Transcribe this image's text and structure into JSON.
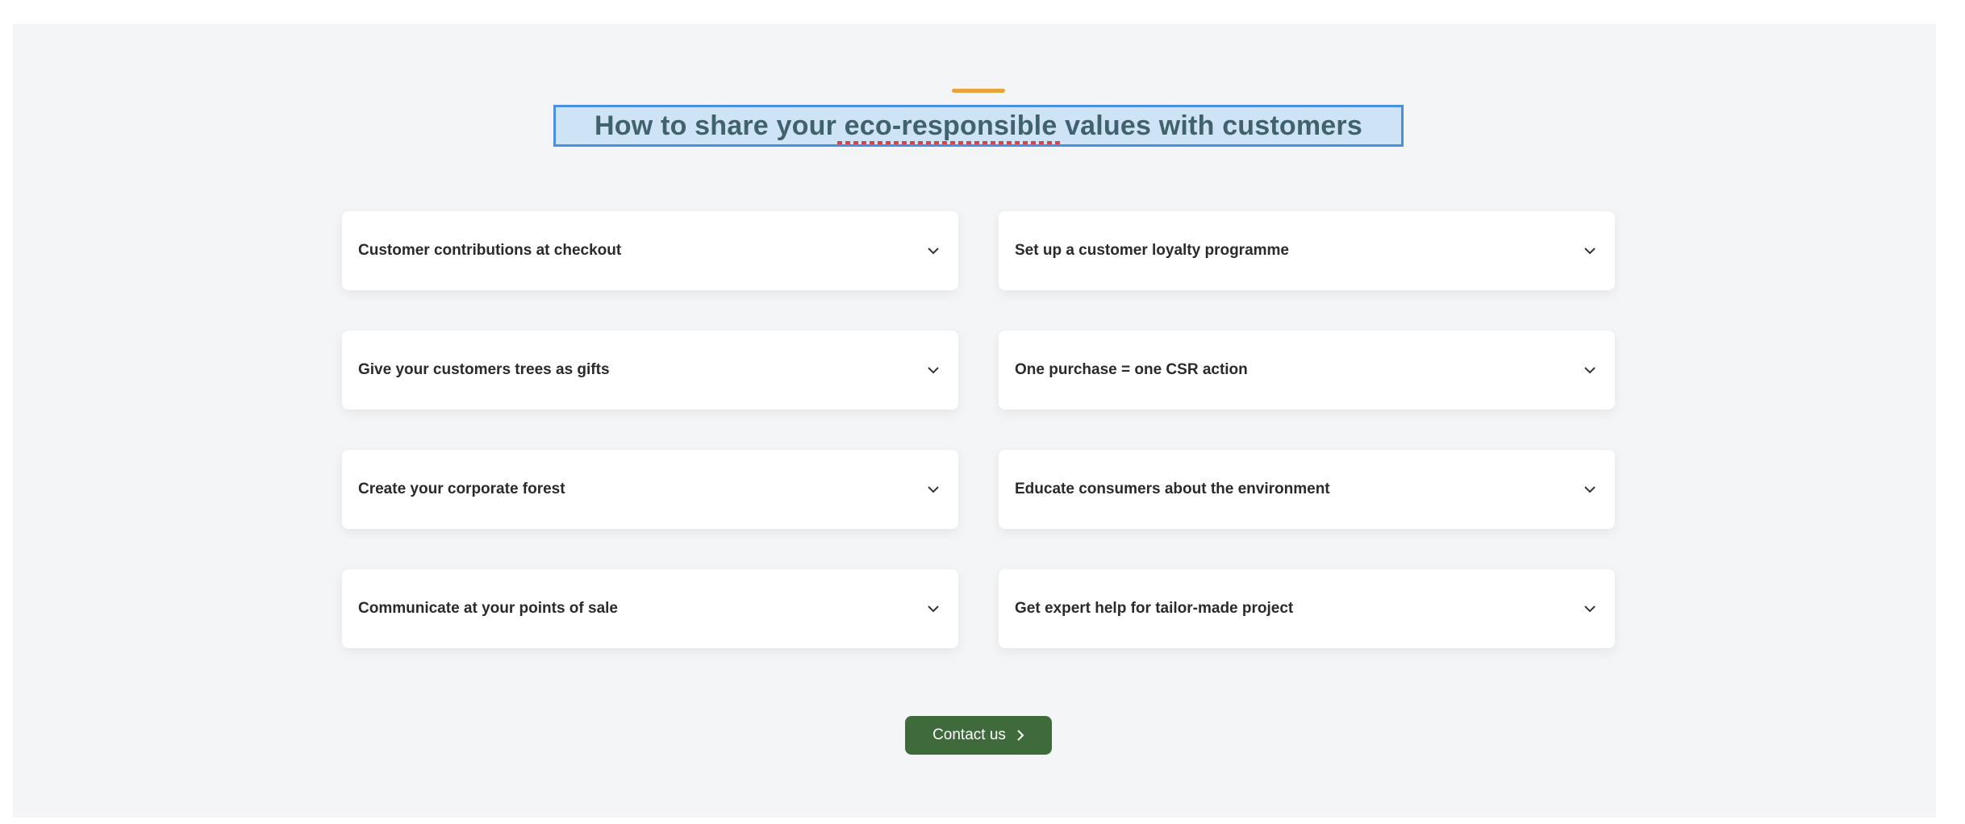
{
  "section": {
    "title": "How to share your eco-responsible values with customers",
    "accent_color": "#e8a33b",
    "title_selection_color": "#4a90e2"
  },
  "accordion": {
    "items": [
      {
        "label": "Customer contributions at checkout",
        "icon": "chevron-down-icon"
      },
      {
        "label": "Set up a customer loyalty programme",
        "icon": "chevron-down-icon"
      },
      {
        "label": "Give your customers trees as gifts",
        "icon": "chevron-down-icon"
      },
      {
        "label": "One purchase = one CSR action",
        "icon": "chevron-down-icon"
      },
      {
        "label": "Create your corporate forest",
        "icon": "chevron-down-icon"
      },
      {
        "label": "Educate consumers about the environment",
        "icon": "chevron-down-icon"
      },
      {
        "label": "Communicate at your points of sale",
        "icon": "chevron-down-icon"
      },
      {
        "label": "Get expert help for tailor-made project",
        "icon": "chevron-down-icon"
      }
    ]
  },
  "cta": {
    "label": "Contact us",
    "icon": "chevron-right-icon",
    "color": "#3f6a3c"
  }
}
